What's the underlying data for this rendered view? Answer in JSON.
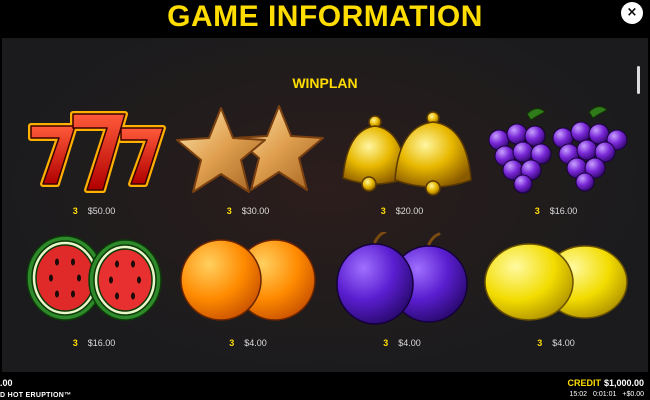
{
  "header": {
    "title": "GAME INFORMATION",
    "close_glyph": "×"
  },
  "section": {
    "title": "WINPLAN"
  },
  "symbols": [
    {
      "name": "seven",
      "count": "3",
      "payout": "$50.00"
    },
    {
      "name": "star",
      "count": "3",
      "payout": "$30.00"
    },
    {
      "name": "bell",
      "count": "3",
      "payout": "$20.00"
    },
    {
      "name": "grapes",
      "count": "3",
      "payout": "$16.00"
    },
    {
      "name": "watermelon",
      "count": "3",
      "payout": "$16.00"
    },
    {
      "name": "orange",
      "count": "3",
      "payout": "$4.00"
    },
    {
      "name": "plum",
      "count": "3",
      "payout": "$4.00"
    },
    {
      "name": "lemon",
      "count": "3",
      "payout": "$4.00"
    }
  ],
  "bottom_bar": {
    "left_value": ".00",
    "game_name": "D HOT ERUPTION™",
    "credit_label": "CREDIT",
    "credit_value": "$1,000.00",
    "time": "15:02",
    "session": "0:01:01",
    "net": "+$0.00"
  },
  "colors": {
    "accent": "#ffdd00",
    "panel": "#1b1b1d",
    "frame": "#cc2a00"
  }
}
